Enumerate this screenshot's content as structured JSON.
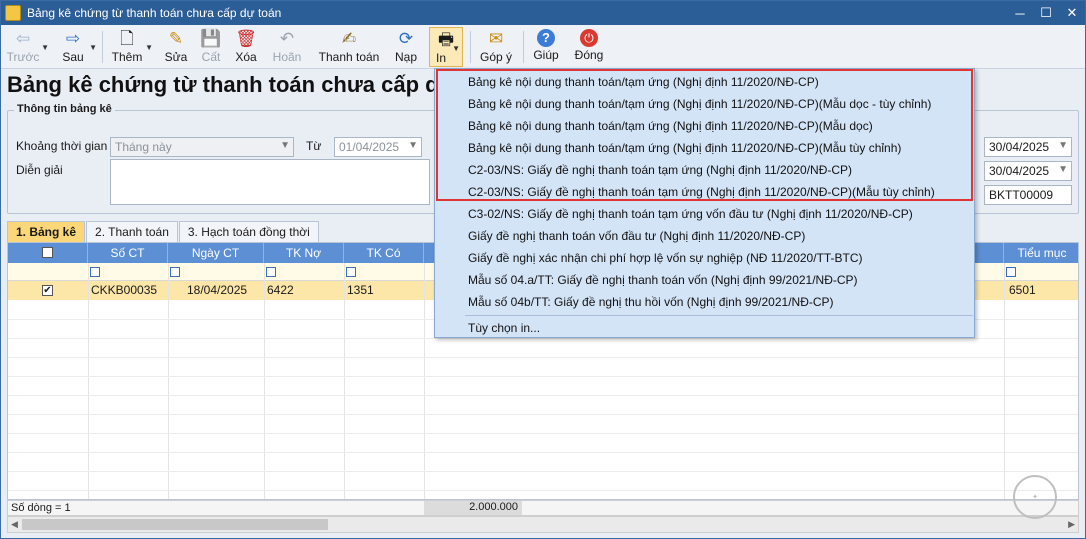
{
  "window": {
    "title": "Bảng kê chứng từ thanh toán chưa cấp dự toán",
    "min": "─",
    "max": "☐",
    "close": "✕"
  },
  "toolbar": {
    "items": [
      {
        "label": "Trước",
        "icon": "⇦"
      },
      {
        "label": "Sau",
        "icon": "⇨"
      },
      {
        "label": "Thêm",
        "icon": "🗋"
      },
      {
        "label": "Sửa",
        "icon": "✎"
      },
      {
        "label": "Cất",
        "icon": "💾"
      },
      {
        "label": "Xóa",
        "icon": "🗑"
      },
      {
        "label": "Hoãn",
        "icon": "↶"
      },
      {
        "label": "Thanh toán",
        "icon": "✍"
      },
      {
        "label": "Nạp",
        "icon": "⟳"
      },
      {
        "label": "In",
        "icon": "🖶"
      },
      {
        "label": "Góp ý",
        "icon": "✉"
      },
      {
        "label": "Giúp",
        "icon": "?"
      },
      {
        "label": "Đóng",
        "icon": "⏻"
      }
    ]
  },
  "page_title": "Bảng kê chứng từ thanh toán chưa cấp d",
  "info": {
    "legend": "Thông tin bảng kê",
    "period_label": "Khoảng thời gian",
    "period_value": "Tháng này",
    "from_label": "Từ",
    "from_value": "01/04/2025",
    "desc_label": "Diễn giải",
    "to_value": "30/04/2025",
    "date2_value": "30/04/2025",
    "code_value": "BKTT00009"
  },
  "tabs": [
    {
      "label": "1. Bảng kê"
    },
    {
      "label": "2. Thanh toán"
    },
    {
      "label": "3. Hạch toán đồng thời"
    }
  ],
  "grid": {
    "columns": [
      "Số CT",
      "Ngày CT",
      "TK Nợ",
      "TK Có",
      "Tiểu mục"
    ],
    "row": {
      "checked": "✔",
      "so_ct": "CKKB00035",
      "ngay_ct": "18/04/2025",
      "tk_no": "6422",
      "tk_co": "1351",
      "tieu_muc": "6501"
    },
    "footer_count": "Số dòng = 1",
    "footer_total": "2.000.000"
  },
  "menu": {
    "items": [
      "Bảng kê nội dung thanh toán/tạm ứng (Nghị định 11/2020/NĐ-CP)",
      "Bảng kê nội dung thanh toán/tạm ứng (Nghị định 11/2020/NĐ-CP)(Mẫu dọc - tùy chỉnh)",
      "Bảng kê nội dung thanh toán/tạm ứng (Nghị định 11/2020/NĐ-CP)(Mẫu dọc)",
      "Bảng kê nội dung thanh toán/tạm ứng (Nghị định 11/2020/NĐ-CP)(Mẫu tùy chỉnh)",
      "C2-03/NS: Giấy đề nghị thanh toán tạm ứng (Nghị định 11/2020/NĐ-CP)",
      "C2-03/NS: Giấy đề nghị thanh toán tạm ứng (Nghị định 11/2020/NĐ-CP)(Mẫu tùy chỉnh)",
      "C3-02/NS: Giấy đề nghị thanh toán tạm ứng vốn đầu tư (Nghị định 11/2020/NĐ-CP)",
      "Giấy đề nghị thanh toán vốn đầu tư (Nghị định 11/2020/NĐ-CP)",
      "Giấy đề nghị xác nhận chi phí hợp lệ vốn sự nghiệp (NĐ 11/2020/TT-BTC)",
      "Mẫu số 04.a/TT: Giấy đề nghị thanh toán vốn (Nghị định 99/2021/NĐ-CP)",
      "Mẫu số 04b/TT: Giấy đề nghị thu hồi vốn (Nghị định 99/2021/NĐ-CP)",
      "Tùy chọn in..."
    ]
  },
  "colors": {
    "accent": "#2b5d96",
    "highlight": "#e03535",
    "selected_row": "#fce6a8"
  }
}
